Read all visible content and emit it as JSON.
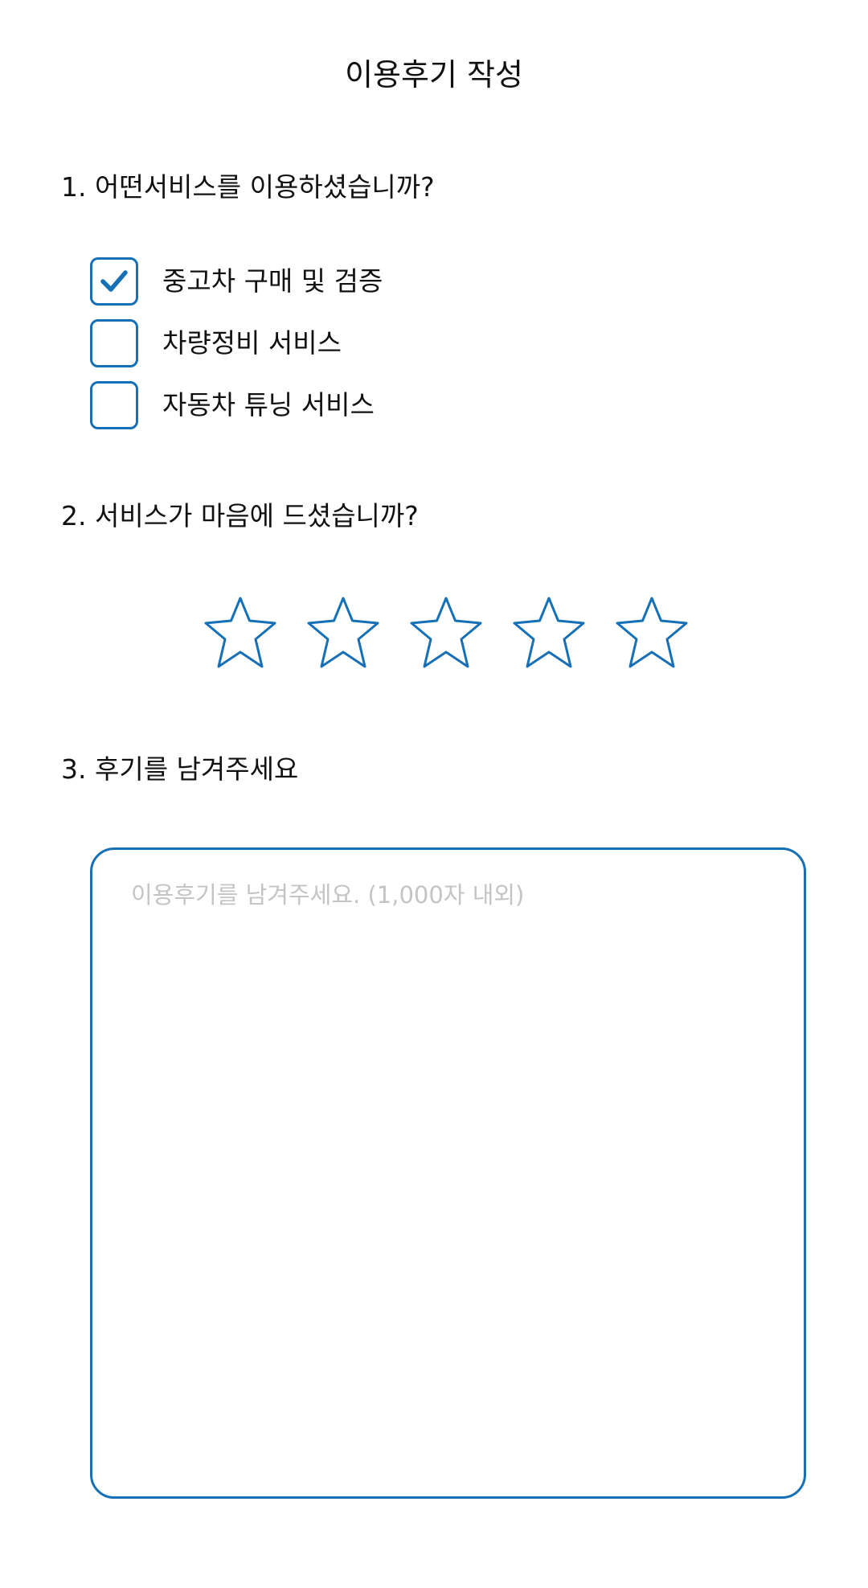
{
  "title": "이용후기 작성",
  "questions": {
    "q1": "1. 어떤서비스를 이용하셨습니까?",
    "q2": "2. 서비스가 마음에 드셨습니까?",
    "q3": "3. 후기를 남겨주세요"
  },
  "services": [
    {
      "label": "중고차 구매 및 검증",
      "checked": true
    },
    {
      "label": "차량정비 서비스",
      "checked": false
    },
    {
      "label": "자동차 튜닝 서비스",
      "checked": false
    }
  ],
  "rating": {
    "value": 0,
    "max": 5
  },
  "review": {
    "placeholder": "이용후기를 남겨주세요. (1,000자 내외)",
    "value": ""
  },
  "colors": {
    "accent": "#1670b6",
    "placeholder": "#c4c4c4",
    "text": "#111111"
  },
  "icons": {
    "checkbox_checked": "check-icon",
    "rating": "star-outline-icon"
  }
}
